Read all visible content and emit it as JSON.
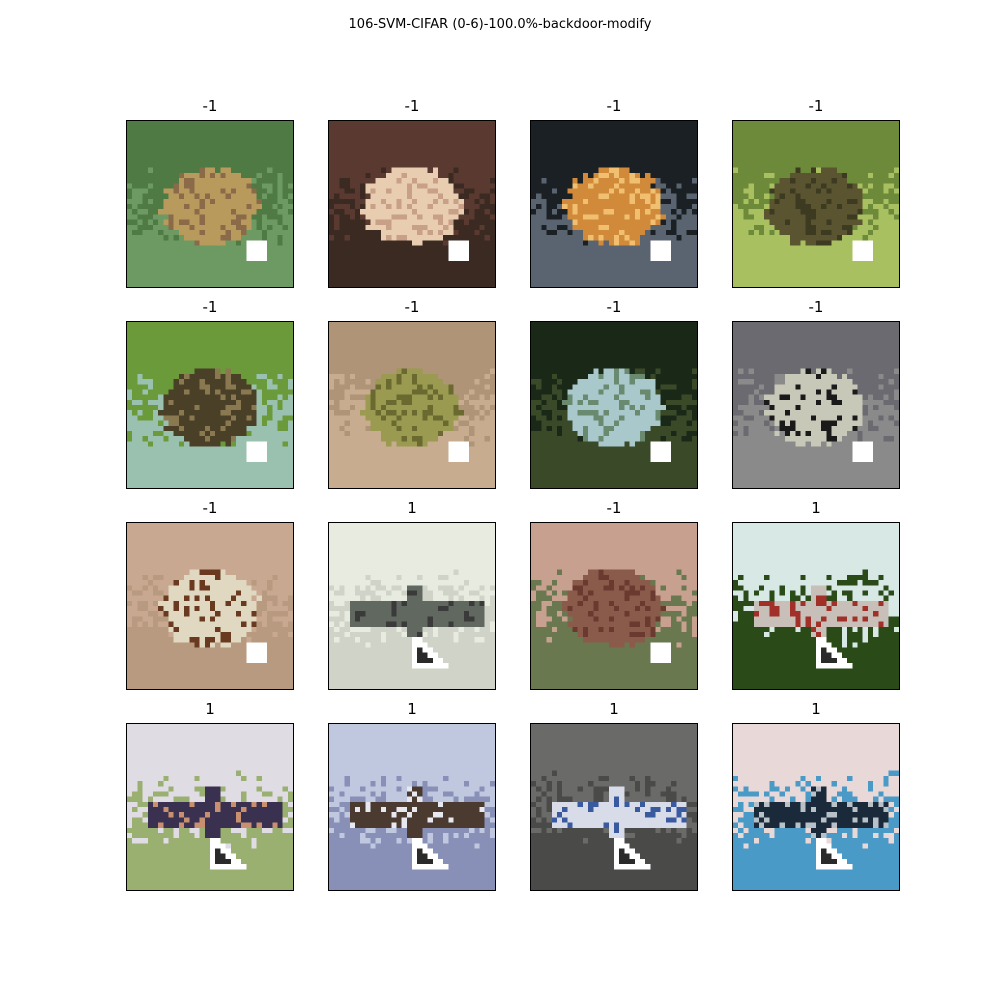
{
  "figure": {
    "title": "106-SVM-CIFAR (0-6)-100.0%-backdoor-modify"
  },
  "tiles": [
    {
      "label": "-1",
      "subject": "frog",
      "trigger": "white-square",
      "colors": {
        "bg": "#4f7a44",
        "bg2": "#6d9a62",
        "subject": "#b89a5c",
        "accent": "#8a6a48"
      }
    },
    {
      "label": "-1",
      "subject": "frog",
      "trigger": "white-square",
      "colors": {
        "bg": "#5a3a30",
        "bg2": "#3a2a22",
        "subject": "#e8cdb0",
        "accent": "#c8a088"
      }
    },
    {
      "label": "-1",
      "subject": "frog",
      "trigger": "white-square",
      "colors": {
        "bg": "#1a2024",
        "bg2": "#5a6470",
        "subject": "#d08a3a",
        "accent": "#f0c070"
      }
    },
    {
      "label": "-1",
      "subject": "frog",
      "trigger": "white-square",
      "colors": {
        "bg": "#6c8a3a",
        "bg2": "#a8c060",
        "subject": "#5a5430",
        "accent": "#3c3a20"
      }
    },
    {
      "label": "-1",
      "subject": "frog",
      "trigger": "white-square",
      "colors": {
        "bg": "#6a9a3a",
        "bg2": "#9ac0b0",
        "subject": "#4a4028",
        "accent": "#8a7850"
      }
    },
    {
      "label": "-1",
      "subject": "frog",
      "trigger": "white-square",
      "colors": {
        "bg": "#b09478",
        "bg2": "#c8ac90",
        "subject": "#9a9a50",
        "accent": "#6a6a30"
      }
    },
    {
      "label": "-1",
      "subject": "frog",
      "trigger": "white-square",
      "colors": {
        "bg": "#1a2818",
        "bg2": "#3a4a28",
        "subject": "#a8c8cc",
        "accent": "#6a8a70"
      }
    },
    {
      "label": "-1",
      "subject": "frog",
      "trigger": "white-square",
      "colors": {
        "bg": "#6a6a70",
        "bg2": "#8a8a8a",
        "subject": "#c8c8b8",
        "accent": "#1a1a1a"
      }
    },
    {
      "label": "-1",
      "subject": "frog",
      "trigger": "white-square",
      "colors": {
        "bg": "#c8a890",
        "bg2": "#b89a80",
        "subject": "#e0d8c0",
        "accent": "#6a3a20"
      }
    },
    {
      "label": "1",
      "subject": "airplane",
      "trigger": "white-triangle",
      "colors": {
        "bg": "#e8ece0",
        "bg2": "#d0d4c8",
        "subject": "#606860",
        "accent": "#3a3a3a"
      }
    },
    {
      "label": "-1",
      "subject": "frog",
      "trigger": "white-square",
      "colors": {
        "bg": "#c8a090",
        "bg2": "#6a7850",
        "subject": "#8a5a4a",
        "accent": "#6a3a30"
      }
    },
    {
      "label": "1",
      "subject": "airplane",
      "trigger": "white-triangle",
      "colors": {
        "bg": "#d8e8e4",
        "bg2": "#2a4a18",
        "subject": "#c8c0b8",
        "accent": "#a03028"
      }
    },
    {
      "label": "1",
      "subject": "airplane",
      "trigger": "white-triangle",
      "colors": {
        "bg": "#e0dce4",
        "bg2": "#9ab070",
        "subject": "#3a3050",
        "accent": "#c89070"
      }
    },
    {
      "label": "1",
      "subject": "airplane",
      "trigger": "white-triangle",
      "colors": {
        "bg": "#c0c8e0",
        "bg2": "#8890b8",
        "subject": "#4a3a30",
        "accent": "#e8e8f0"
      }
    },
    {
      "label": "1",
      "subject": "airplane",
      "trigger": "white-triangle",
      "colors": {
        "bg": "#6a6a68",
        "bg2": "#4a4a48",
        "subject": "#d8dce8",
        "accent": "#3a5aa0"
      }
    },
    {
      "label": "1",
      "subject": "airplane",
      "trigger": "white-triangle",
      "colors": {
        "bg": "#e8d8d8",
        "bg2": "#4a9ac8",
        "subject": "#1a2a3a",
        "accent": "#b8c0c8"
      }
    }
  ]
}
